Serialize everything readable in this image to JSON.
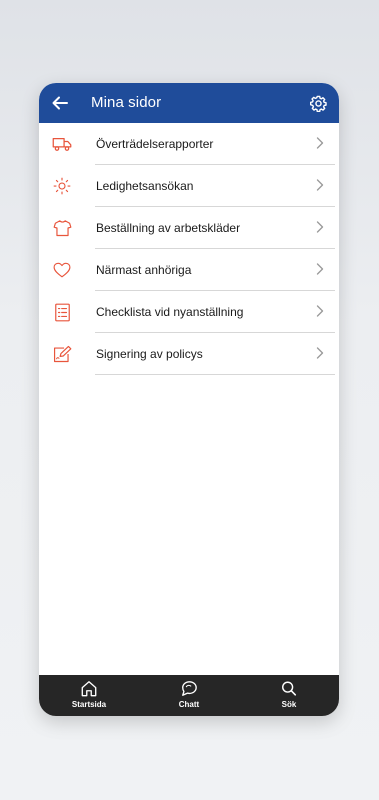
{
  "header": {
    "title": "Mina sidor",
    "back_icon": "arrow-left-icon",
    "settings_icon": "gear-icon",
    "background_color": "#1f4c9a"
  },
  "menu": {
    "accent_color": "#e8553c",
    "items": [
      {
        "label": "Överträdelserapporter",
        "icon": "truck-icon"
      },
      {
        "label": "Ledighetsansökan",
        "icon": "sun-icon"
      },
      {
        "label": "Beställning av arbetskläder",
        "icon": "shirt-icon"
      },
      {
        "label": "Närmast anhöriga",
        "icon": "heart-icon"
      },
      {
        "label": "Checklista vid nyanställning",
        "icon": "checklist-icon"
      },
      {
        "label": "Signering av policys",
        "icon": "signing-icon"
      }
    ]
  },
  "tabbar": {
    "background_color": "#262626",
    "tabs": [
      {
        "label": "Startsida",
        "icon": "home-icon"
      },
      {
        "label": "Chatt",
        "icon": "chat-icon"
      },
      {
        "label": "Sök",
        "icon": "search-icon"
      }
    ]
  }
}
